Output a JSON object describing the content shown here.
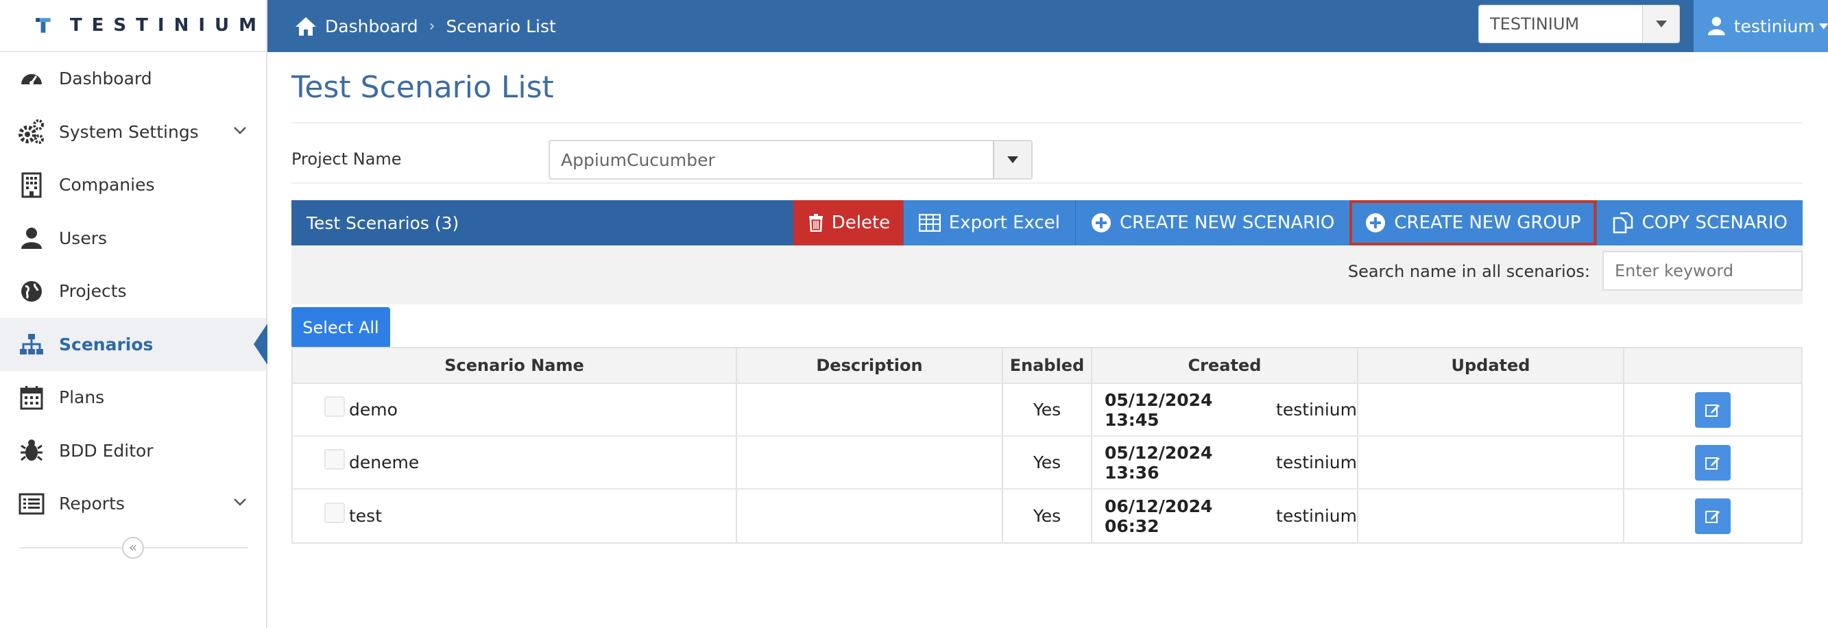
{
  "brand": {
    "name": "TESTINIUM"
  },
  "sidebar": {
    "items": [
      {
        "label": "Dashboard",
        "icon": "dashboard-icon"
      },
      {
        "label": "System Settings",
        "icon": "gears-icon",
        "expandable": true
      },
      {
        "label": "Companies",
        "icon": "building-icon"
      },
      {
        "label": "Users",
        "icon": "user-icon"
      },
      {
        "label": "Projects",
        "icon": "globe-icon"
      },
      {
        "label": "Scenarios",
        "icon": "sitemap-icon",
        "active": true
      },
      {
        "label": "Plans",
        "icon": "calendar-icon"
      },
      {
        "label": "BDD Editor",
        "icon": "bug-icon"
      },
      {
        "label": "Reports",
        "icon": "list-icon",
        "expandable": true
      }
    ],
    "collapse_glyph": "«"
  },
  "topbar": {
    "breadcrumb": {
      "home": "Dashboard",
      "separator": "›",
      "current": "Scenario List"
    },
    "project_selector": "TESTINIUM",
    "user": "testinium"
  },
  "page": {
    "title": "Test Scenario List",
    "project_name_label": "Project Name",
    "project_name_value": "AppiumCucumber"
  },
  "panel": {
    "title": "Test Scenarios (3)",
    "buttons": {
      "delete": "Delete",
      "export": "Export Excel",
      "new_scenario": "CREATE NEW SCENARIO",
      "new_group": "CREATE NEW GROUP",
      "copy": "COPY SCENARIO"
    },
    "search_label": "Search name in all scenarios:",
    "search_placeholder": "Enter keyword",
    "select_all": "Select All"
  },
  "table": {
    "headers": [
      "Scenario Name",
      "Description",
      "Enabled",
      "Created",
      "Updated",
      ""
    ],
    "rows": [
      {
        "name": "demo",
        "description": "",
        "enabled": "Yes",
        "created_date": "05/12/2024 13:45",
        "created_by": "testinium",
        "updated": ""
      },
      {
        "name": "deneme",
        "description": "",
        "enabled": "Yes",
        "created_date": "05/12/2024 13:36",
        "created_by": "testinium",
        "updated": ""
      },
      {
        "name": "test",
        "description": "",
        "enabled": "Yes",
        "created_date": "06/12/2024 06:32",
        "created_by": "testinium",
        "updated": ""
      }
    ]
  },
  "colors": {
    "topbar": "#336aa5",
    "panel_header": "#2f64a3",
    "delete": "#c9302c",
    "action": "#3f87d6",
    "highlight_outline": "#c0392b",
    "active_nav": "#2f6aa6"
  }
}
